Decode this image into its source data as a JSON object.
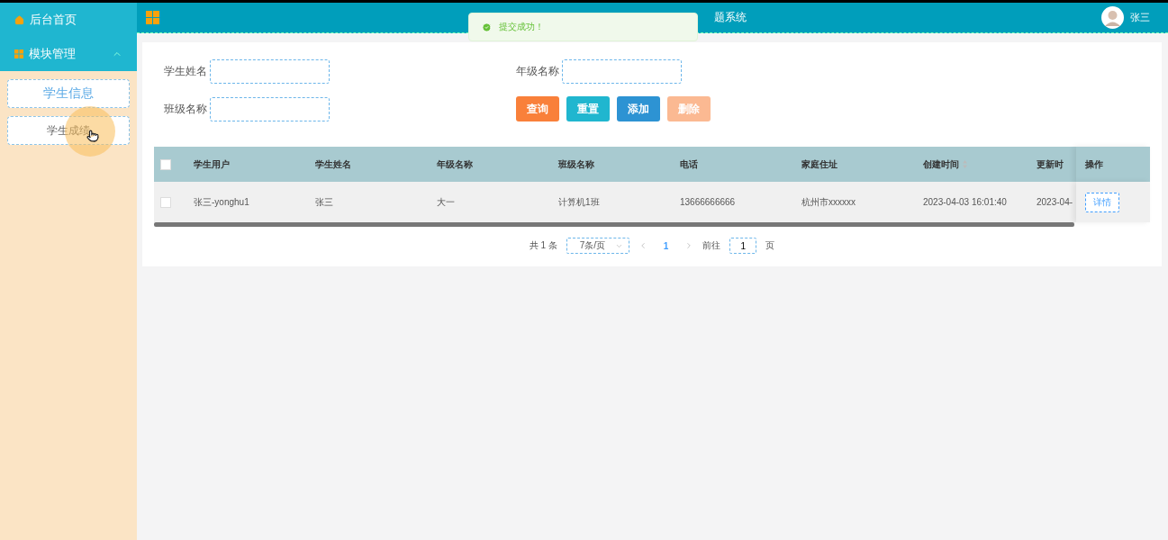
{
  "sidebar": {
    "items": [
      {
        "label": "后台首页",
        "kind": "home"
      },
      {
        "label": "模块管理",
        "kind": "group",
        "expanded": true,
        "children": [
          {
            "label": "学生信息",
            "selected": true
          },
          {
            "label": "学生成绩",
            "selected": false
          }
        ]
      }
    ]
  },
  "header": {
    "title": "题系统",
    "user": "张三"
  },
  "toast": {
    "message": "提交成功！"
  },
  "search": {
    "fields": [
      {
        "label": "学生姓名"
      },
      {
        "label": "年级名称"
      },
      {
        "label": "班级名称"
      }
    ],
    "buttons": [
      {
        "label": "查询",
        "kind": "search",
        "disabled": false
      },
      {
        "label": "重置",
        "kind": "reset",
        "disabled": false
      },
      {
        "label": "添加",
        "kind": "add",
        "disabled": false
      },
      {
        "label": "删除",
        "kind": "delete",
        "disabled": true
      }
    ]
  },
  "table": {
    "header_checked": false,
    "columns": [
      {
        "label": "学生用户",
        "sortable": false
      },
      {
        "label": "学生姓名",
        "sortable": false
      },
      {
        "label": "年级名称",
        "sortable": false
      },
      {
        "label": "班级名称",
        "sortable": false
      },
      {
        "label": "电话",
        "sortable": false
      },
      {
        "label": "家庭住址",
        "sortable": false
      },
      {
        "label": "创建时间",
        "sortable": true
      },
      {
        "label": "更新时",
        "sortable": false
      }
    ],
    "action_column": "操作",
    "rows": [
      {
        "checked": false,
        "cells": [
          "张三-yonghu1",
          "张三",
          "大一",
          "计算机1班",
          "13666666666",
          "杭州市xxxxxx",
          "2023-04-03 16:01:40",
          "2023-04-"
        ],
        "action": "详情"
      }
    ]
  },
  "pagination": {
    "total": "共 1 条",
    "page_size": "7条/页",
    "pages": [
      {
        "label": "1",
        "selected": true
      }
    ],
    "goto_label": "前往",
    "goto_value": "1",
    "goto_suffix": "页"
  }
}
